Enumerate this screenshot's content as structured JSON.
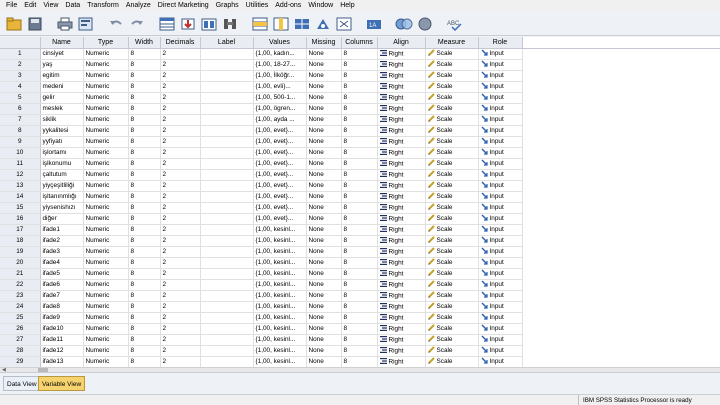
{
  "menu": [
    {
      "label": "File"
    },
    {
      "label": "Edit"
    },
    {
      "label": "View"
    },
    {
      "label": "Data"
    },
    {
      "label": "Transform"
    },
    {
      "label": "Analyze"
    },
    {
      "label": "Direct Marketing"
    },
    {
      "label": "Graphs"
    },
    {
      "label": "Utilities"
    },
    {
      "label": "Add-ons"
    },
    {
      "label": "Window"
    },
    {
      "label": "Help"
    }
  ],
  "toolbar": {
    "icons": [
      "open-folder-icon",
      "save-icon",
      "print-icon",
      "dialog-recall-icon",
      "undo-icon",
      "redo-icon",
      "goto-case-icon",
      "goto-variable-icon",
      "variables-icon",
      "find-icon",
      "insert-cases-icon",
      "insert-variable-icon",
      "split-file-icon",
      "weight-cases-icon",
      "select-cases-icon",
      "value-labels-icon",
      "use-sets-icon",
      "show-all-variables-icon",
      "spell-check-icon"
    ]
  },
  "grid": {
    "headers": [
      "",
      "Name",
      "Type",
      "Width",
      "Decimals",
      "Label",
      "Values",
      "Missing",
      "Columns",
      "Align",
      "Measure",
      "Role"
    ],
    "rows": [
      {
        "n": "1",
        "name": "cinsiyet",
        "type": "Numeric",
        "width": "8",
        "dec": "2",
        "label": "",
        "values": "{1,00, kadın...",
        "missing": "None",
        "columns": "8",
        "align": "Right",
        "measure": "Scale",
        "role": "Input"
      },
      {
        "n": "2",
        "name": "yaş",
        "type": "Numeric",
        "width": "8",
        "dec": "2",
        "label": "",
        "values": "{1,00, 18-27...",
        "missing": "None",
        "columns": "8",
        "align": "Right",
        "measure": "Scale",
        "role": "Input"
      },
      {
        "n": "3",
        "name": "egitim",
        "type": "Numeric",
        "width": "8",
        "dec": "2",
        "label": "",
        "values": "{1,00, İlköğr...",
        "missing": "None",
        "columns": "8",
        "align": "Right",
        "measure": "Scale",
        "role": "Input"
      },
      {
        "n": "4",
        "name": "medeni",
        "type": "Numeric",
        "width": "8",
        "dec": "2",
        "label": "",
        "values": "{1,00, evli}...",
        "missing": "None",
        "columns": "8",
        "align": "Right",
        "measure": "Scale",
        "role": "Input"
      },
      {
        "n": "5",
        "name": "gelir",
        "type": "Numeric",
        "width": "8",
        "dec": "2",
        "label": "",
        "values": "{1,00, 500-1...",
        "missing": "None",
        "columns": "8",
        "align": "Right",
        "measure": "Scale",
        "role": "Input"
      },
      {
        "n": "6",
        "name": "meslek",
        "type": "Numeric",
        "width": "8",
        "dec": "2",
        "label": "",
        "values": "{1,00, ögren...",
        "missing": "None",
        "columns": "8",
        "align": "Right",
        "measure": "Scale",
        "role": "Input"
      },
      {
        "n": "7",
        "name": "siklik",
        "type": "Numeric",
        "width": "8",
        "dec": "2",
        "label": "",
        "values": "{1,00, ayda ...",
        "missing": "None",
        "columns": "8",
        "align": "Right",
        "measure": "Scale",
        "role": "Input"
      },
      {
        "n": "8",
        "name": "yykalitesi",
        "type": "Numeric",
        "width": "8",
        "dec": "2",
        "label": "",
        "values": "{1,00, evet}...",
        "missing": "None",
        "columns": "8",
        "align": "Right",
        "measure": "Scale",
        "role": "Input"
      },
      {
        "n": "9",
        "name": "yyfiyatı",
        "type": "Numeric",
        "width": "8",
        "dec": "2",
        "label": "",
        "values": "{1,00, evet}...",
        "missing": "None",
        "columns": "8",
        "align": "Right",
        "measure": "Scale",
        "role": "Input"
      },
      {
        "n": "10",
        "name": "işlortamı",
        "type": "Numeric",
        "width": "8",
        "dec": "2",
        "label": "",
        "values": "{1,00, evet}...",
        "missing": "None",
        "columns": "8",
        "align": "Right",
        "measure": "Scale",
        "role": "Input"
      },
      {
        "n": "11",
        "name": "işlkonumu",
        "type": "Numeric",
        "width": "8",
        "dec": "2",
        "label": "",
        "values": "{1,00, evet}...",
        "missing": "None",
        "columns": "8",
        "align": "Right",
        "measure": "Scale",
        "role": "Input"
      },
      {
        "n": "12",
        "name": "çaltutum",
        "type": "Numeric",
        "width": "8",
        "dec": "2",
        "label": "",
        "values": "{1,00, evet}...",
        "missing": "None",
        "columns": "8",
        "align": "Right",
        "measure": "Scale",
        "role": "Input"
      },
      {
        "n": "13",
        "name": "yiyçeşitliliği",
        "type": "Numeric",
        "width": "8",
        "dec": "2",
        "label": "",
        "values": "{1,00, evet}...",
        "missing": "None",
        "columns": "8",
        "align": "Right",
        "measure": "Scale",
        "role": "Input"
      },
      {
        "n": "14",
        "name": "işltanınmlığı",
        "type": "Numeric",
        "width": "8",
        "dec": "2",
        "label": "",
        "values": "{1,00, evet}...",
        "missing": "None",
        "columns": "8",
        "align": "Right",
        "measure": "Scale",
        "role": "Input"
      },
      {
        "n": "15",
        "name": "yiysenishızı",
        "type": "Numeric",
        "width": "8",
        "dec": "2",
        "label": "",
        "values": "{1,00, evet}...",
        "missing": "None",
        "columns": "8",
        "align": "Right",
        "measure": "Scale",
        "role": "Input"
      },
      {
        "n": "16",
        "name": "diğer",
        "type": "Numeric",
        "width": "8",
        "dec": "2",
        "label": "",
        "values": "{1,00, evet}...",
        "missing": "None",
        "columns": "8",
        "align": "Right",
        "measure": "Scale",
        "role": "Input"
      },
      {
        "n": "17",
        "name": "ifade1",
        "type": "Numeric",
        "width": "8",
        "dec": "2",
        "label": "",
        "values": "{1,00, kesinl...",
        "missing": "None",
        "columns": "8",
        "align": "Right",
        "measure": "Scale",
        "role": "Input"
      },
      {
        "n": "18",
        "name": "ifade2",
        "type": "Numeric",
        "width": "8",
        "dec": "2",
        "label": "",
        "values": "{1,00, kesinl...",
        "missing": "None",
        "columns": "8",
        "align": "Right",
        "measure": "Scale",
        "role": "Input"
      },
      {
        "n": "19",
        "name": "ifade3",
        "type": "Numeric",
        "width": "8",
        "dec": "2",
        "label": "",
        "values": "{1,00, kesinl...",
        "missing": "None",
        "columns": "8",
        "align": "Right",
        "measure": "Scale",
        "role": "Input"
      },
      {
        "n": "20",
        "name": "ifade4",
        "type": "Numeric",
        "width": "8",
        "dec": "2",
        "label": "",
        "values": "{1,00, kesinl...",
        "missing": "None",
        "columns": "8",
        "align": "Right",
        "measure": "Scale",
        "role": "Input"
      },
      {
        "n": "21",
        "name": "ifade5",
        "type": "Numeric",
        "width": "8",
        "dec": "2",
        "label": "",
        "values": "{1,00, kesinl...",
        "missing": "None",
        "columns": "8",
        "align": "Right",
        "measure": "Scale",
        "role": "Input"
      },
      {
        "n": "22",
        "name": "ifade6",
        "type": "Numeric",
        "width": "8",
        "dec": "2",
        "label": "",
        "values": "{1,00, kesinl...",
        "missing": "None",
        "columns": "8",
        "align": "Right",
        "measure": "Scale",
        "role": "Input"
      },
      {
        "n": "23",
        "name": "ifade7",
        "type": "Numeric",
        "width": "8",
        "dec": "2",
        "label": "",
        "values": "{1,00, kesinl...",
        "missing": "None",
        "columns": "8",
        "align": "Right",
        "measure": "Scale",
        "role": "Input"
      },
      {
        "n": "24",
        "name": "ifade8",
        "type": "Numeric",
        "width": "8",
        "dec": "2",
        "label": "",
        "values": "{1,00, kesinl...",
        "missing": "None",
        "columns": "8",
        "align": "Right",
        "measure": "Scale",
        "role": "Input"
      },
      {
        "n": "25",
        "name": "ifade9",
        "type": "Numeric",
        "width": "8",
        "dec": "2",
        "label": "",
        "values": "{1,00, kesinl...",
        "missing": "None",
        "columns": "8",
        "align": "Right",
        "measure": "Scale",
        "role": "Input"
      },
      {
        "n": "26",
        "name": "ifade10",
        "type": "Numeric",
        "width": "8",
        "dec": "2",
        "label": "",
        "values": "{1,00, kesinl...",
        "missing": "None",
        "columns": "8",
        "align": "Right",
        "measure": "Scale",
        "role": "Input"
      },
      {
        "n": "27",
        "name": "ifade11",
        "type": "Numeric",
        "width": "8",
        "dec": "2",
        "label": "",
        "values": "{1,00, kesinl...",
        "missing": "None",
        "columns": "8",
        "align": "Right",
        "measure": "Scale",
        "role": "Input"
      },
      {
        "n": "28",
        "name": "ifade12",
        "type": "Numeric",
        "width": "8",
        "dec": "2",
        "label": "",
        "values": "{1,00, kesinl...",
        "missing": "None",
        "columns": "8",
        "align": "Right",
        "measure": "Scale",
        "role": "Input"
      },
      {
        "n": "29",
        "name": "ifade13",
        "type": "Numeric",
        "width": "8",
        "dec": "2",
        "label": "",
        "values": "{1,00, kesinl...",
        "missing": "None",
        "columns": "8",
        "align": "Right",
        "measure": "Scale",
        "role": "Input"
      }
    ]
  },
  "tabs": [
    {
      "label": "Data View",
      "active": false
    },
    {
      "label": "Variable View",
      "active": true
    }
  ],
  "status": {
    "message": "IBM SPSS Statistics Processor is ready"
  },
  "colors": {
    "active_tab": "#f6d36f",
    "header_bg": "#e9edf3",
    "align_icon": "#1f2f5c",
    "measure_icon": "#c8a227",
    "role_icon": "#2a5fb0"
  }
}
